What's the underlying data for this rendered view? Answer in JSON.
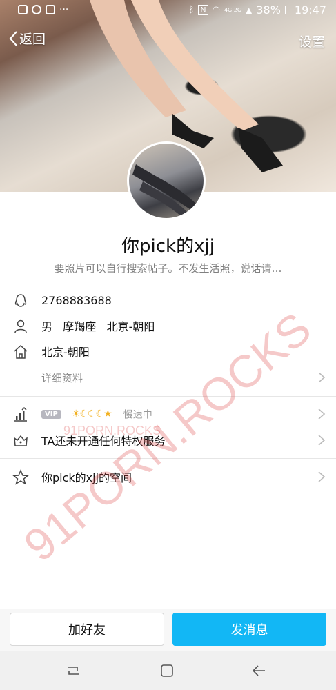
{
  "status_bar": {
    "battery": "38%",
    "time": "19:47",
    "network": "4G 2G"
  },
  "header": {
    "back_label": "返回",
    "settings_label": "设置"
  },
  "profile": {
    "name": "你pick的xjj",
    "bio": "要照片可以自行搜索帖子。不发生活照，说话请…"
  },
  "info": {
    "qq": "2768883688",
    "gender": "男",
    "zodiac": "摩羯座",
    "location": "北京-朝阳",
    "hometown": "北京-朝阳",
    "details_label": "详细资料"
  },
  "level": {
    "vip_badge": "VIP",
    "level_icons": "☀☾☾☾★",
    "speed_label": "慢速中"
  },
  "privilege": {
    "label": "TA还未开通任何特权服务"
  },
  "space": {
    "label": "你pick的xjj的空间"
  },
  "actions": {
    "add_friend": "加好友",
    "send_message": "发消息"
  },
  "watermark": {
    "main": "91PORN.ROCKS",
    "small": "91PORN.ROCKS"
  },
  "colors": {
    "accent": "#12b7f5",
    "level_gold": "#f2b01e"
  }
}
